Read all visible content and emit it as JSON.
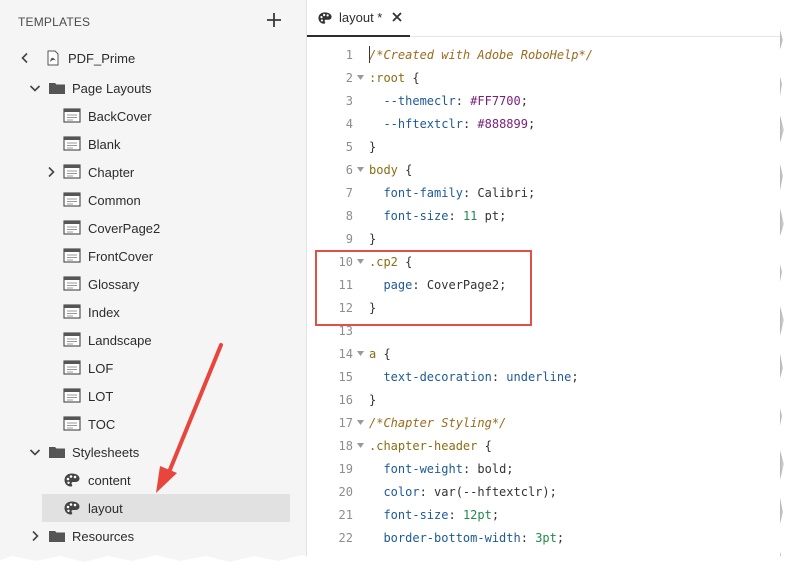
{
  "panel": {
    "title": "TEMPLATES"
  },
  "tree": {
    "root": {
      "label": "PDF_Prime"
    },
    "page_layouts": {
      "label": "Page Layouts",
      "items": [
        "BackCover",
        "Blank",
        "Chapter",
        "Common",
        "CoverPage2",
        "FrontCover",
        "Glossary",
        "Index",
        "Landscape",
        "LOF",
        "LOT",
        "TOC"
      ]
    },
    "stylesheets": {
      "label": "Stylesheets",
      "items": [
        "content",
        "layout"
      ],
      "selected": "layout"
    },
    "resources": {
      "label": "Resources"
    }
  },
  "tab": {
    "label": "layout *"
  },
  "code": {
    "lines": [
      {
        "n": "1",
        "fold": false
      },
      {
        "n": "2",
        "fold": true
      },
      {
        "n": "3",
        "fold": false
      },
      {
        "n": "4",
        "fold": false
      },
      {
        "n": "5",
        "fold": false
      },
      {
        "n": "6",
        "fold": true
      },
      {
        "n": "7",
        "fold": false
      },
      {
        "n": "8",
        "fold": false
      },
      {
        "n": "9",
        "fold": false
      },
      {
        "n": "10",
        "fold": true
      },
      {
        "n": "11",
        "fold": false
      },
      {
        "n": "12",
        "fold": false
      },
      {
        "n": "13",
        "fold": false
      },
      {
        "n": "14",
        "fold": true
      },
      {
        "n": "15",
        "fold": false
      },
      {
        "n": "16",
        "fold": false
      },
      {
        "n": "17",
        "fold": true
      },
      {
        "n": "18",
        "fold": true
      },
      {
        "n": "19",
        "fold": false
      },
      {
        "n": "20",
        "fold": false
      },
      {
        "n": "21",
        "fold": false
      },
      {
        "n": "22",
        "fold": false
      }
    ],
    "l1_comment": "/*Created with Adobe RoboHelp*/",
    "l2_sel": ":root",
    "l2_brace": " {",
    "l3_prop": "--themeclr",
    "l3_val": "#FF7700",
    "l4_prop": "--hftextclr",
    "l4_val": "#888899",
    "l5": "}",
    "l6_sel": "body",
    "l6_brace": " {",
    "l7_prop": "font-family",
    "l7_val": "Calibri",
    "l8_prop": "font-size",
    "l8_num": "11",
    "l8_unit": "pt",
    "l9": "}",
    "l10_sel": ".cp2",
    "l10_brace": " {",
    "l11_prop": "page",
    "l11_val": "CoverPage2",
    "l12": "}",
    "l14_sel": "a",
    "l14_brace": " {",
    "l15_prop": "text-decoration",
    "l15_val": "underline",
    "l16": "}",
    "l17_comment": "/*Chapter Styling*/",
    "l18_sel": ".chapter-header",
    "l18_brace": " {",
    "l19_prop": "font-weight",
    "l19_val": "bold",
    "l20_prop": "color",
    "l20_val": "var(--hftextclr)",
    "l21_prop": "font-size",
    "l21_num": "12pt",
    "l22_prop": "border-bottom-width",
    "l22_num": "3pt"
  },
  "colors": {
    "highlight": "#e0504a",
    "arrow": "#e8453c",
    "selected_row": "#e1e1e1"
  }
}
